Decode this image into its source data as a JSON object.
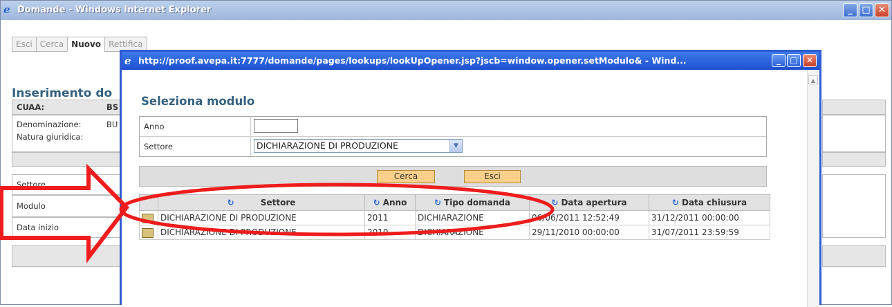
{
  "main_window": {
    "title": "Domande - Windows Internet Explorer",
    "tabs": [
      {
        "label": "Esci"
      },
      {
        "label": "Cerca"
      },
      {
        "label": "Nuovo"
      },
      {
        "label": "Rettifica"
      }
    ],
    "heading": "Inserimento do",
    "rows": {
      "cuaa_label": "CUAA:",
      "cuaa_value": "BS",
      "denominazione_label": "Denominazione:",
      "denominazione_value": "BU",
      "natura_label": "Natura giuridica:",
      "settore_label": "Settore",
      "modulo_label": "Modulo",
      "data_inizio_label": "Data inizio"
    }
  },
  "popup": {
    "title": "http://proof.avepa.it:7777/domande/pages/lookups/lookUpOpener.jsp?jscb=window.opener.setModulo& - Wind...",
    "heading": "Seleziona modulo",
    "form": {
      "anno_label": "Anno",
      "anno_value": "",
      "settore_label": "Settore",
      "settore_selected": "DICHIARAZIONE DI PRODUZIONE"
    },
    "buttons": {
      "cerca": "Cerca",
      "esci": "Esci"
    },
    "table": {
      "headers": [
        "Settore",
        "Anno",
        "Tipo domanda",
        "Data apertura",
        "Data chiusura"
      ],
      "rows": [
        {
          "settore": "DICHIARAZIONE DI PRODUZIONE",
          "anno": "2011",
          "tipo": "DICHIARAZIONE",
          "apertura": "06/06/2011 12:52:49",
          "chiusura": "31/12/2011 00:00:00"
        },
        {
          "settore": "DICHIARAZIONE DI PRODUZIONE",
          "anno": "2010",
          "tipo": "DICHIARAZIONE",
          "apertura": "29/11/2010 00:00:00",
          "chiusura": "31/07/2011 23:59:59"
        }
      ]
    }
  },
  "colors": {
    "arrow": "#ee1c1c",
    "accent": "#34627f",
    "button": "#fcd08a"
  },
  "icons": [
    "ie-icon",
    "minimize-icon",
    "maximize-icon",
    "close-icon",
    "sort-icon",
    "folder-icon",
    "dropdown-arrow-icon",
    "scroll-up-icon"
  ]
}
